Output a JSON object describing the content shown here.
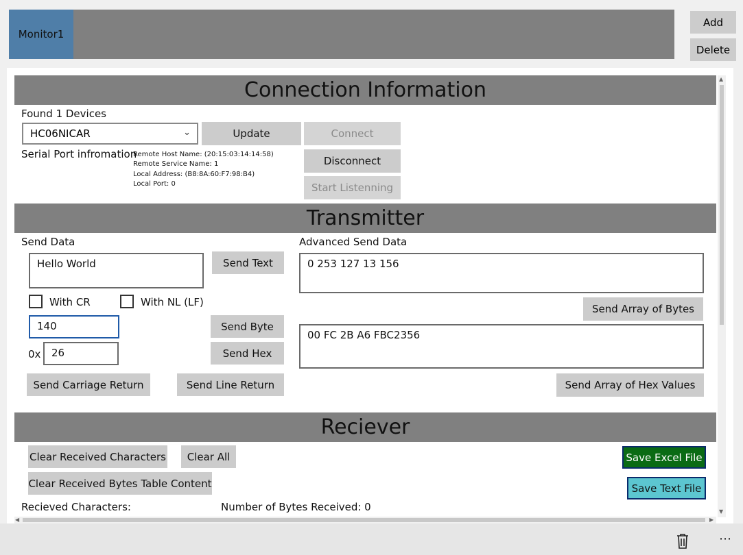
{
  "tabs": [
    {
      "label": "Monitor1"
    }
  ],
  "top_buttons": {
    "add": "Add",
    "delete": "Delete"
  },
  "connection": {
    "header": "Connection Information",
    "found_devices": "Found 1 Devices",
    "device_selected": "HC06NICAR",
    "update": "Update",
    "connect": "Connect",
    "disconnect": "Disconnect",
    "start_listening": "Start Listenning",
    "serial_label": "Serial Port infromation",
    "info": [
      "Remote Host Name: (20:15:03:14:14:58)",
      "Remote Service Name: 1",
      "Local Address: (B8:8A:60:F7:98:B4)",
      "Local Port: 0"
    ]
  },
  "transmitter": {
    "header": "Transmitter",
    "send_data_label": "Send Data",
    "send_text_value": "Hello World",
    "send_text": "Send Text",
    "with_cr": "With CR",
    "with_nl": "With NL (LF)",
    "byte_value": "140",
    "send_byte": "Send Byte",
    "hex_prefix": "0x",
    "hex_value": "26",
    "send_hex": "Send Hex",
    "send_cr": "Send Carriage Return",
    "send_lr": "Send Line Return",
    "advanced_label": "Advanced Send Data",
    "bytes_array_value": "0 253 127 13 156",
    "send_bytes": "Send Array of Bytes",
    "hex_array_value": "00 FC 2B A6 FBC2356",
    "send_hex_array": "Send Array of Hex Values"
  },
  "receiver": {
    "header": "Reciever",
    "clear_chars": "Clear Received Characters",
    "clear_all": "Clear All",
    "clear_table": "Clear Received Bytes Table Content",
    "save_excel": "Save Excel File",
    "save_text": "Save Text File",
    "received_chars": "Recieved Characters:",
    "bytes_received": "Number of Bytes Received: 0"
  },
  "colors": {
    "tab_selected": "#4f7ea8",
    "header_bg": "#808080",
    "save_excel_bg": "#0a6b14",
    "save_text_bg": "#5cc6d0",
    "focus_border": "#1f5aa8"
  },
  "icons": {
    "delete": "trash-icon",
    "more": "more-icon",
    "dropdown": "chevron-down-icon"
  }
}
